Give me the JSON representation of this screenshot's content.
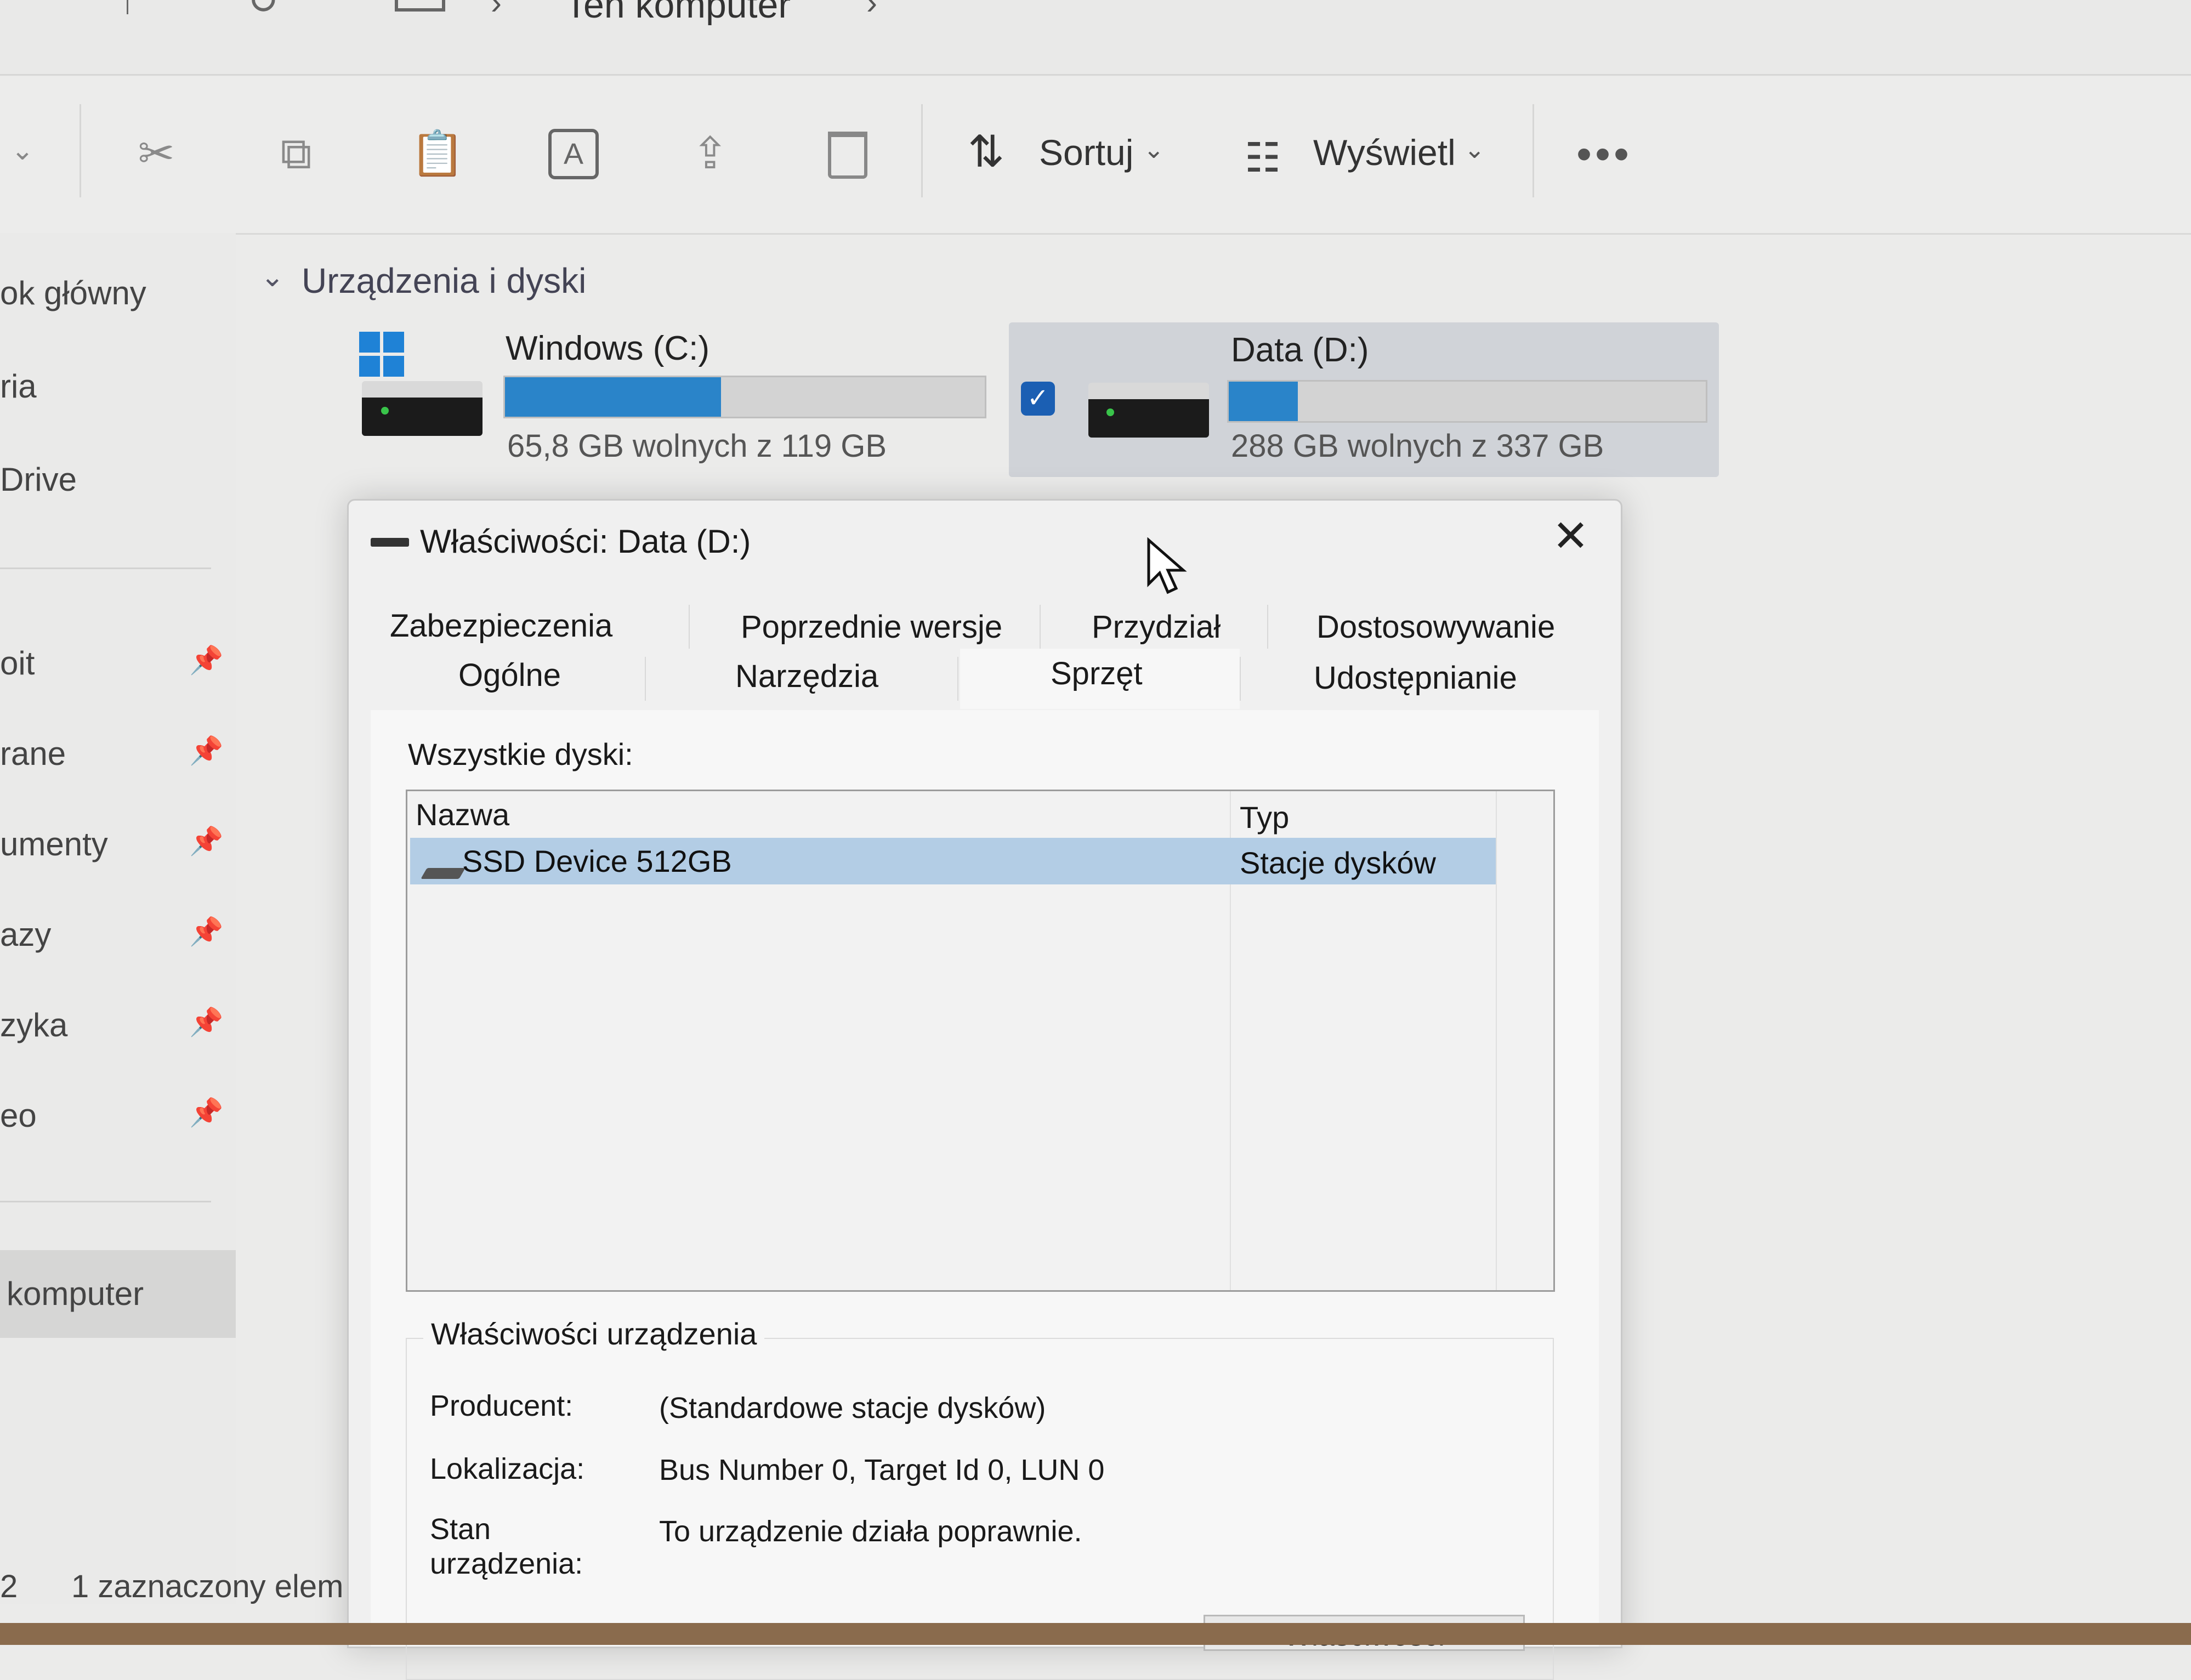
{
  "explorer": {
    "breadcrumb": "Ten komputer",
    "toolbar": {
      "sort_label": "Sortuj",
      "view_label": "Wyświetl",
      "more_label": "•••"
    },
    "sidebar": {
      "items": [
        "ok główny",
        "ria",
        "Drive",
        "oit",
        "rane",
        "umenty",
        "azy",
        "zyka",
        "eo"
      ],
      "active_item": "komputer"
    },
    "section_title": "Urządzenia i dyski",
    "drives": [
      {
        "name": "Windows (C:)",
        "free_text": "65,8 GB wolnych z 119 GB",
        "used_fraction": 0.45
      },
      {
        "name": "Data (D:)",
        "free_text": "288 GB wolnych z 337 GB",
        "used_fraction": 0.145,
        "selected": true
      }
    ],
    "status": {
      "count": "2",
      "selection": "1 zaznaczony elem"
    }
  },
  "dialog": {
    "title": "Właściwości: Data (D:)",
    "tabs_row1": [
      "Zabezpieczenia",
      "Poprzednie wersje",
      "Przydział",
      "Dostosowywanie"
    ],
    "tabs_row2": [
      "Ogólne",
      "Narzędzia",
      "Sprzęt",
      "Udostępnianie"
    ],
    "selected_tab": "Sprzęt",
    "all_disks_label": "Wszystkie dyski:",
    "columns": {
      "name": "Nazwa",
      "type": "Typ"
    },
    "rows": [
      {
        "name": "SSD Device 512GB",
        "type": "Stacje dysków"
      }
    ],
    "device_props": {
      "legend": "Właściwości urządzenia",
      "producer_label": "Producent:",
      "producer_value": "(Standardowe stacje dysków)",
      "location_label": "Lokalizacja:",
      "location_value": "Bus Number 0, Target Id 0, LUN 0",
      "status_label_1": "Stan",
      "status_label_2": "urządzenia:",
      "status_value": "To urządzenie działa poprawnie.",
      "properties_button": "Właściwości"
    }
  }
}
